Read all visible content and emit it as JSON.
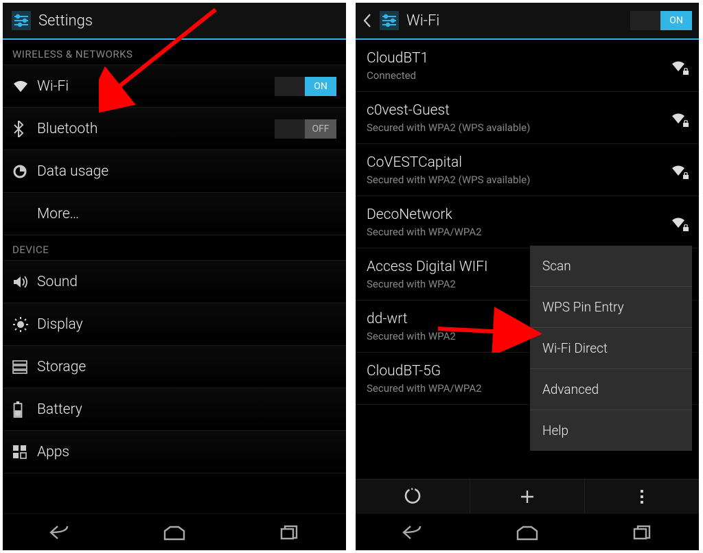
{
  "left": {
    "title": "Settings",
    "sections": {
      "wireless_header": "WIRELESS & NETWORKS",
      "device_header": "DEVICE"
    },
    "items": {
      "wifi": {
        "label": "Wi-Fi",
        "toggle": "ON"
      },
      "bluetooth": {
        "label": "Bluetooth",
        "toggle": "OFF"
      },
      "data_usage": {
        "label": "Data usage"
      },
      "more": {
        "label": "More…"
      },
      "sound": {
        "label": "Sound"
      },
      "display": {
        "label": "Display"
      },
      "storage": {
        "label": "Storage"
      },
      "battery": {
        "label": "Battery"
      },
      "apps": {
        "label": "Apps"
      }
    }
  },
  "right": {
    "title": "Wi-Fi",
    "header_toggle": "ON",
    "networks": [
      {
        "name": "CloudBT1",
        "sub": "Connected",
        "secured": true
      },
      {
        "name": "c0vest-Guest",
        "sub": "Secured with WPA2 (WPS available)",
        "secured": true
      },
      {
        "name": "CoVESTCapital",
        "sub": "Secured with WPA2 (WPS available)",
        "secured": true
      },
      {
        "name": "DecoNetwork",
        "sub": "Secured with WPA/WPA2",
        "secured": true
      },
      {
        "name": "Access Digital WIFI",
        "sub": "Secured with WPA2",
        "secured": true
      },
      {
        "name": "dd-wrt",
        "sub": "Secured with WPA2",
        "secured": true
      },
      {
        "name": "CloudBT-5G",
        "sub": "Secured with WPA/WPA2",
        "secured": true
      }
    ],
    "popup": {
      "items": [
        {
          "label": "Scan"
        },
        {
          "label": "WPS Pin Entry"
        },
        {
          "label": "Wi-Fi Direct"
        },
        {
          "label": "Advanced"
        },
        {
          "label": "Help"
        }
      ]
    }
  },
  "colors": {
    "accent": "#33b5e5"
  }
}
